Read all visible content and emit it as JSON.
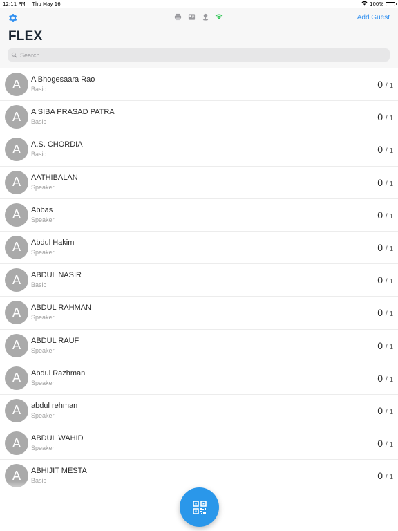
{
  "status_bar": {
    "time": "12:11 PM",
    "date": "Thu May 16",
    "battery": "100%"
  },
  "header": {
    "title": "FLEX",
    "add_guest_label": "Add Guest",
    "settings_icon": "gear-icon",
    "toolbar_icons": [
      "printer-icon",
      "badge-icon",
      "location-icon",
      "wifi-icon"
    ],
    "accent_color": "#2f8ff0"
  },
  "search": {
    "placeholder": "Search",
    "value": ""
  },
  "guests": [
    {
      "initial": "A",
      "name": "A Bhogesaara Rao",
      "type": "Basic",
      "checked": "0",
      "total": "1"
    },
    {
      "initial": "A",
      "name": "A SIBA PRASAD PATRA",
      "type": "Basic",
      "checked": "0",
      "total": "1"
    },
    {
      "initial": "A",
      "name": "A.S. CHORDIA",
      "type": "Basic",
      "checked": "0",
      "total": "1"
    },
    {
      "initial": "A",
      "name": "AATHIBALAN",
      "type": "Speaker",
      "checked": "0",
      "total": "1"
    },
    {
      "initial": "A",
      "name": "Abbas",
      "type": "Speaker",
      "checked": "0",
      "total": "1"
    },
    {
      "initial": "A",
      "name": "Abdul Hakim",
      "type": "Speaker",
      "checked": "0",
      "total": "1"
    },
    {
      "initial": "A",
      "name": "ABDUL NASIR",
      "type": "Basic",
      "checked": "0",
      "total": "1"
    },
    {
      "initial": "A",
      "name": "ABDUL RAHMAN",
      "type": "Speaker",
      "checked": "0",
      "total": "1"
    },
    {
      "initial": "A",
      "name": "ABDUL RAUF",
      "type": "Speaker",
      "checked": "0",
      "total": "1"
    },
    {
      "initial": "A",
      "name": "Abdul Razhman",
      "type": "Speaker",
      "checked": "0",
      "total": "1"
    },
    {
      "initial": "A",
      "name": "abdul rehman",
      "type": "Speaker",
      "checked": "0",
      "total": "1"
    },
    {
      "initial": "A",
      "name": "ABDUL WAHID",
      "type": "Speaker",
      "checked": "0",
      "total": "1"
    },
    {
      "initial": "A",
      "name": "ABHIJIT MESTA",
      "type": "Basic",
      "checked": "0",
      "total": "1"
    }
  ],
  "scan_button": {
    "icon": "qr-code-icon",
    "color": "#2a97ea"
  }
}
